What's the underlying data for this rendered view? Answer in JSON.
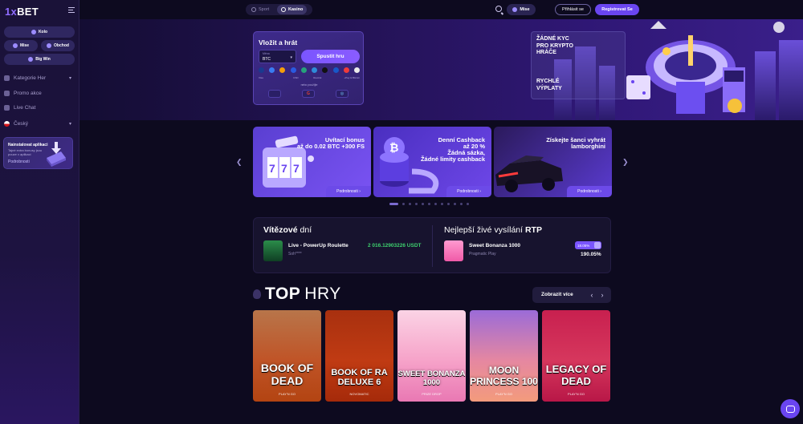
{
  "brand": {
    "logo_x": "1x",
    "logo_rest": "BET"
  },
  "sidebar": {
    "kolo": "Kolo",
    "mise": "Mise",
    "obchod": "Obchod",
    "bigwin": "Big Win",
    "items": [
      {
        "label": "Kategorie Her",
        "icon": "grid-icon",
        "has_chevron": true
      },
      {
        "label": "Promo akce",
        "icon": "gift-icon",
        "has_chevron": false
      },
      {
        "label": "Live Chat",
        "icon": "chat-icon",
        "has_chevron": false
      },
      {
        "label": "Český",
        "icon": "czech-flag-icon",
        "has_chevron": true
      }
    ],
    "app": {
      "title": "Nainstalovat aplikaci",
      "desc": "Tajné extra bonusy jsou pouze v aplikaci",
      "link": "Podrobnosti"
    }
  },
  "topbar": {
    "tab_sport": "Sport",
    "tab_kasino": "Kasino",
    "mise": "Mise",
    "login": "Přihlásit se",
    "register": "Registrovat Se"
  },
  "deposit": {
    "title": "Vložit a hrát",
    "currency_label": "Měna",
    "currency_value": "BTC",
    "play_button": "Spustit hru",
    "coins": [
      {
        "label": "Visa",
        "color": "#1a3a8f"
      },
      {
        "label": "",
        "color": "#3a7cf2"
      },
      {
        "label": "",
        "color": "#f59e0b"
      },
      {
        "label": "",
        "color": "#2a5ae0"
      },
      {
        "label": "USD",
        "color": "#26a17b"
      },
      {
        "label": "",
        "color": "#2e8bd8"
      },
      {
        "label": "Revolut",
        "color": "#111"
      },
      {
        "label": "",
        "color": "#1858c8"
      },
      {
        "label": "",
        "color": "#ef3b3b"
      },
      {
        "label": "+Pay & Bitcoin",
        "color": "#eaeaea"
      }
    ],
    "or_use": "nebo použijte",
    "pay_methods": [
      "",
      "G",
      "◎"
    ]
  },
  "hero_promo": {
    "line_a": [
      "ŽÁDNÉ KYC",
      "PRO KRYPTO",
      "HRÁČE"
    ],
    "line_b": [
      "RYCHLÉ",
      "VÝPLATY"
    ]
  },
  "promo_cards": [
    {
      "title_lines": [
        "Uvítací bonus",
        "až do 0.02 BTC +300 FS"
      ],
      "more": "Podrobnosti",
      "bg": "linear-gradient(135deg,#5a3fd1,#7a53f3)"
    },
    {
      "title_lines": [
        "Denní Cashback",
        "až 20 %",
        "Žádná sázka,",
        "Žádné limity cashback"
      ],
      "more": "Podrobnosti",
      "bg": "linear-gradient(135deg,#4a2fc0,#6e47e8)"
    },
    {
      "title_lines": [
        "Získejte šanci vyhrát",
        "lamborghini"
      ],
      "more": "Podrobnosti",
      "bg": "linear-gradient(135deg,#2b1a5c,#5a3bd0)"
    }
  ],
  "carousel": {
    "count": 12,
    "active": 0
  },
  "winners": {
    "title_bold": "Vítězové",
    "title_rest": "dní",
    "game": "Live - PowerUp Roulette",
    "user": "Soh****",
    "amount": "2 016.12903226 USDT"
  },
  "rtp": {
    "title_rest": "Nejlepší živé vysílání",
    "title_bold": "RTP",
    "game": "Sweet Bonanza 1000",
    "provider": "Pragmatic Play",
    "badge": "18.05%",
    "value": "190.05%"
  },
  "top_games": {
    "title_bold": "TOP",
    "title_rest": "HRY",
    "more": "Zobrazit více",
    "games": [
      {
        "name": "BOOK OF DEAD",
        "provider": "PLAY'N GO",
        "bg": "linear-gradient(180deg,#b8754a,#c05427 55%,#b34412)",
        "size": "14px"
      },
      {
        "name": "BOOK OF RA DELUXE 6",
        "provider": "NOVOMATIC",
        "bg": "linear-gradient(180deg,#a8300f,#c03b13 55%,#a52a0a)",
        "size": "11px"
      },
      {
        "name": "SWEET BONANZA 1000",
        "provider": "PRIZE DROP",
        "bg": "linear-gradient(180deg,#fbd3e5,#f6a3c9 55%,#e978b3)",
        "size": "9.5px"
      },
      {
        "name": "MOON PRINCESS 100",
        "provider": "PLAY'N GO",
        "bg": "linear-gradient(180deg,#9b6bd8,#e587a1 55%,#f39b7c)",
        "size": "12px"
      },
      {
        "name": "LEGACY OF DEAD",
        "provider": "PLAY'N GO",
        "bg": "linear-gradient(180deg,#c8204f,#d6375d 55%,#b81747)",
        "size": "13px"
      }
    ]
  },
  "colors": {
    "accent": "#6a45f0",
    "win_green": "#3ed16e",
    "bg": "#0d0a1f"
  }
}
